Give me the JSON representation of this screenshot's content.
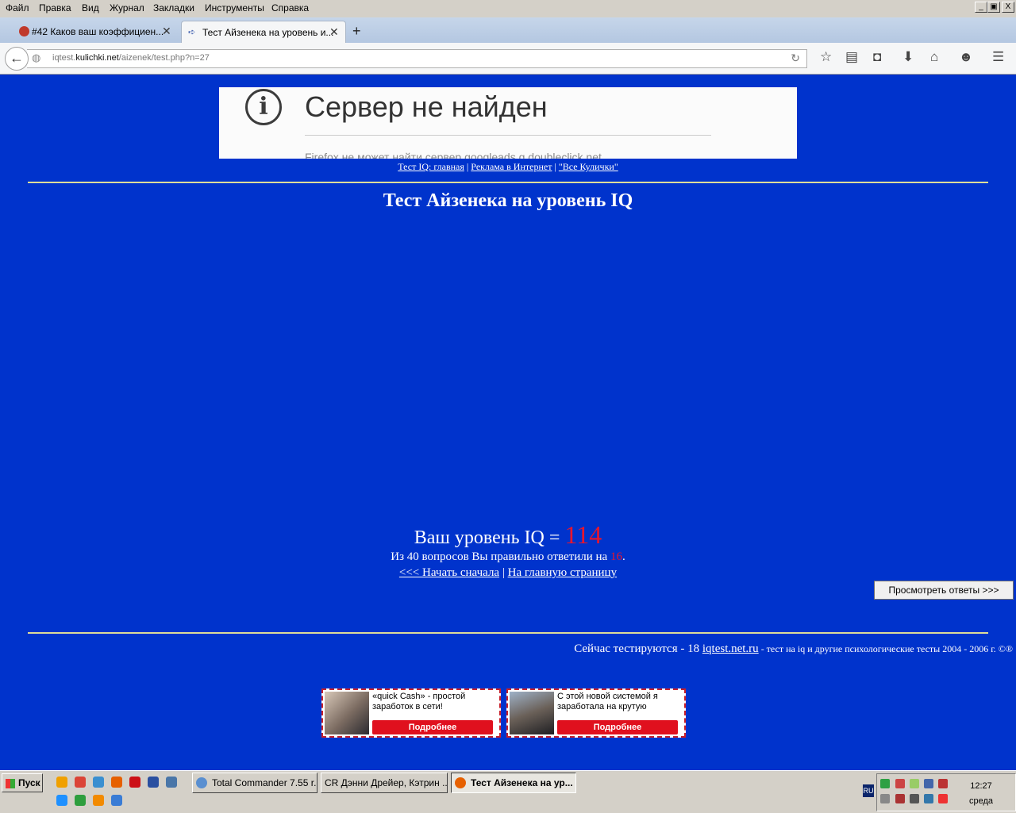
{
  "menu": [
    "Файл",
    "Правка",
    "Вид",
    "Журнал",
    "Закладки",
    "Инструменты",
    "Справка"
  ],
  "window_controls": {
    "minimize": "_",
    "restore": "▣",
    "close": "X"
  },
  "tabs": [
    {
      "label": "#42 Каков ваш коэффициен...",
      "active": false
    },
    {
      "label": "Тест Айзенека на уровень и...",
      "active": true
    }
  ],
  "url": {
    "prefix": "iqtest.",
    "domain": "kulichki.net",
    "path": "/aizenek/test.php?n=27"
  },
  "error_frame": {
    "title": "Сервер не найден",
    "description": "Firefox не может найти сервер googleads.g.doubleclick.net."
  },
  "top_links": [
    "Тест IQ: главная",
    "Реклама в Интернет",
    "\"Все Кулички\""
  ],
  "page_title": "Тест Айзенека на уровень IQ",
  "result": {
    "prefix": "Ваш уровень IQ = ",
    "iq": "114",
    "detail_prefix": "Из 40 вопросов Вы правильно ответили на ",
    "correct": "16",
    "detail_suffix": "."
  },
  "result_links": {
    "restart": "<<< Начать сначала",
    "home": "На главную страницу"
  },
  "answers_button": "Просмотреть ответы >>>",
  "footer": {
    "testing": "Сейчас тестируются - 18 ",
    "site": "iqtest.net.ru",
    "tagline": " - тест на iq и другие психологические тесты 2004 - 2006 г. ©®"
  },
  "ads": [
    {
      "text": "«quick Cash» - простой заработок в сети!",
      "button": "Подробнее"
    },
    {
      "text": "С этой новой системой я заработала на крутую",
      "button": "Подробнее"
    }
  ],
  "taskbar": {
    "start": "Пуск",
    "tasks": [
      {
        "label": "Total Commander 7.55 r...",
        "active": false
      },
      {
        "label": "CR  Дэнни Дрейер, Кэтрин ...",
        "active": false
      },
      {
        "label": "Тест Айзенека на ур...",
        "active": true
      }
    ],
    "lang": "RU",
    "time": "12:27",
    "day": "среда"
  },
  "colors": {
    "page_bg": "#0033cc",
    "iq_accent": "#e8152d",
    "hr_color": "#dddd99",
    "ad_button": "#e0101e"
  }
}
